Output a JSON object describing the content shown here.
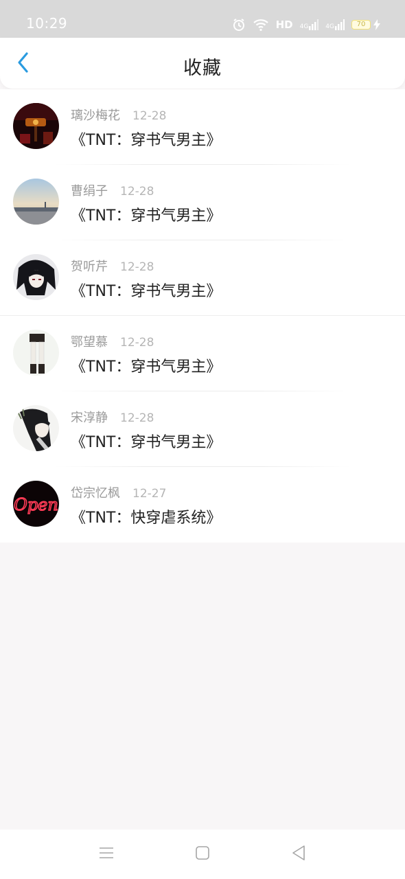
{
  "status_bar": {
    "time": "10:29",
    "network_label": "HD",
    "signal1": "4G",
    "signal2": "4G",
    "battery": "70",
    "icons": [
      "alarm-icon",
      "wifi-icon",
      "signal-icon",
      "battery-icon",
      "charging-icon"
    ]
  },
  "header": {
    "title": "收藏",
    "back_icon": "chevron-left-icon",
    "accent_color": "#2a9be0"
  },
  "favorites": [
    {
      "name": "璃沙梅花",
      "date": "12-28",
      "book": "《TNT：穿书气男主》"
    },
    {
      "name": "曹绢子",
      "date": "12-28",
      "book": "《TNT：穿书气男主》"
    },
    {
      "name": "贺听芹",
      "date": "12-28",
      "book": "《TNT：穿书气男主》"
    },
    {
      "name": "鄂望慕",
      "date": "12-28",
      "book": "《TNT：穿书气男主》"
    },
    {
      "name": "宋淳静",
      "date": "12-28",
      "book": "《TNT：穿书气男主》"
    },
    {
      "name": "岱宗忆枫",
      "date": "12-27",
      "book": "《TNT：快穿虐系统》"
    }
  ],
  "avatar_logo_text": "Open",
  "nav_bar": {
    "icons": [
      "menu-icon",
      "home-square-icon",
      "back-triangle-icon"
    ]
  }
}
